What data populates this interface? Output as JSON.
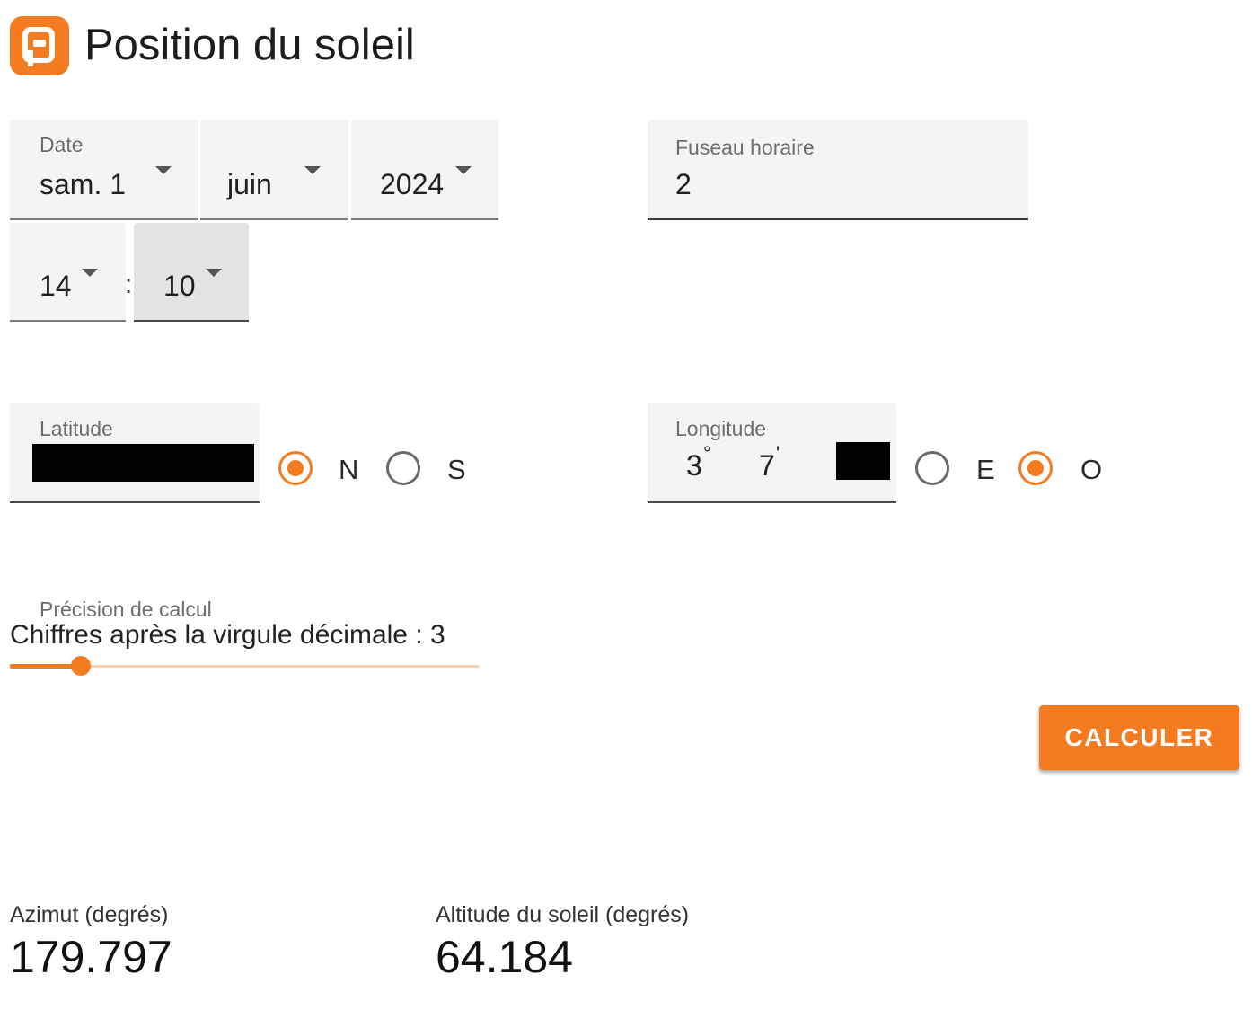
{
  "header": {
    "title": "Position du soleil",
    "logo_icon": "app-logo-icon"
  },
  "date": {
    "label": "Date",
    "day": "sam. 1",
    "month": "juin",
    "year": "2024"
  },
  "timezone": {
    "label": "Fuseau horaire",
    "value": "2"
  },
  "time": {
    "hour": "14",
    "separator": ":",
    "minute": "10"
  },
  "latitude": {
    "label": "Latitude",
    "options": [
      "N",
      "S"
    ],
    "selected": "N"
  },
  "longitude": {
    "label": "Longitude",
    "degrees": "3",
    "degree_symbol": "°",
    "minutes": "7",
    "minute_symbol": "'",
    "options": [
      "E",
      "O"
    ],
    "selected": "O"
  },
  "precision": {
    "label": "Précision de calcul",
    "text": "Chiffres après la virgule décimale : 3",
    "value": 3
  },
  "actions": {
    "calculate": "CALCULER"
  },
  "results": {
    "azimuth_label": "Azimut (degrés)",
    "azimuth_value": "179.797",
    "altitude_label": "Altitude du soleil (degrés)",
    "altitude_value": "64.184"
  },
  "colors": {
    "accent": "#f47b20"
  }
}
